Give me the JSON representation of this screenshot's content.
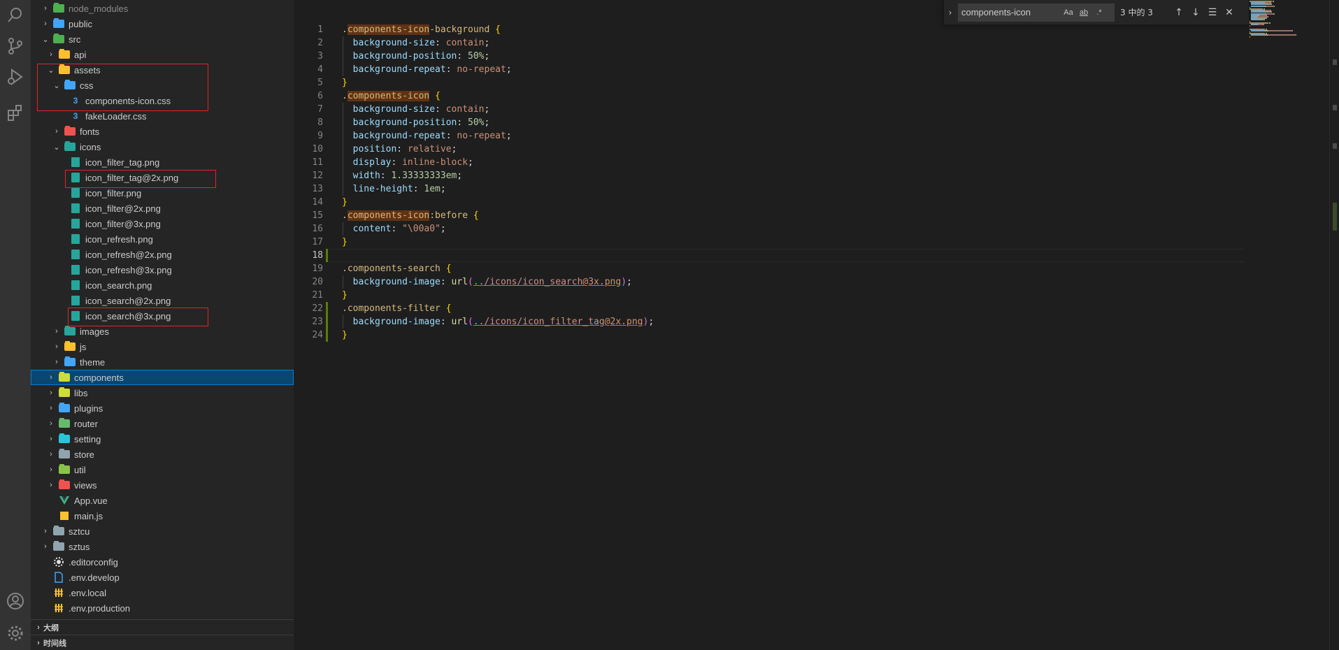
{
  "activity_bar": {
    "items": [
      {
        "name": "search-icon"
      },
      {
        "name": "source-control-icon"
      },
      {
        "name": "run-debug-icon"
      },
      {
        "name": "extensions-icon"
      }
    ],
    "bottom": [
      {
        "name": "account-icon"
      },
      {
        "name": "settings-gear-icon"
      }
    ]
  },
  "explorer": {
    "items": [
      {
        "label": "node_modules",
        "depth": 1,
        "type": "folder",
        "expanded": false,
        "color": "#4caf50",
        "dim": true
      },
      {
        "label": "public",
        "depth": 1,
        "type": "folder",
        "expanded": false,
        "color": "#42a5f5"
      },
      {
        "label": "src",
        "depth": 1,
        "type": "folder",
        "expanded": true,
        "color": "#4caf50"
      },
      {
        "label": "api",
        "depth": 2,
        "type": "folder",
        "expanded": false,
        "color": "#fbc02d"
      },
      {
        "label": "assets",
        "depth": 2,
        "type": "folder",
        "expanded": true,
        "color": "#fbc02d"
      },
      {
        "label": "css",
        "depth": 3,
        "type": "folder",
        "expanded": true,
        "color": "#42a5f5"
      },
      {
        "label": "components-icon.css",
        "depth": 4,
        "type": "css"
      },
      {
        "label": "fakeLoader.css",
        "depth": 4,
        "type": "css"
      },
      {
        "label": "fonts",
        "depth": 3,
        "type": "folder",
        "expanded": false,
        "color": "#ef5350"
      },
      {
        "label": "icons",
        "depth": 3,
        "type": "folder",
        "expanded": true,
        "color": "#26a69a"
      },
      {
        "label": "icon_filter_tag.png",
        "depth": 4,
        "type": "img"
      },
      {
        "label": "icon_filter_tag@2x.png",
        "depth": 4,
        "type": "img"
      },
      {
        "label": "icon_filter.png",
        "depth": 4,
        "type": "img"
      },
      {
        "label": "icon_filter@2x.png",
        "depth": 4,
        "type": "img"
      },
      {
        "label": "icon_filter@3x.png",
        "depth": 4,
        "type": "img"
      },
      {
        "label": "icon_refresh.png",
        "depth": 4,
        "type": "img"
      },
      {
        "label": "icon_refresh@2x.png",
        "depth": 4,
        "type": "img"
      },
      {
        "label": "icon_refresh@3x.png",
        "depth": 4,
        "type": "img"
      },
      {
        "label": "icon_search.png",
        "depth": 4,
        "type": "img"
      },
      {
        "label": "icon_search@2x.png",
        "depth": 4,
        "type": "img"
      },
      {
        "label": "icon_search@3x.png",
        "depth": 4,
        "type": "img"
      },
      {
        "label": "images",
        "depth": 3,
        "type": "folder",
        "expanded": false,
        "color": "#26a69a"
      },
      {
        "label": "js",
        "depth": 3,
        "type": "folder",
        "expanded": false,
        "color": "#fbc02d"
      },
      {
        "label": "theme",
        "depth": 3,
        "type": "folder",
        "expanded": false,
        "color": "#42a5f5"
      },
      {
        "label": "components",
        "depth": 2,
        "type": "folder",
        "expanded": false,
        "color": "#cddc39",
        "selected": true
      },
      {
        "label": "libs",
        "depth": 2,
        "type": "folder",
        "expanded": false,
        "color": "#cddc39"
      },
      {
        "label": "plugins",
        "depth": 2,
        "type": "folder",
        "expanded": false,
        "color": "#42a5f5"
      },
      {
        "label": "router",
        "depth": 2,
        "type": "folder",
        "expanded": false,
        "color": "#66bb6a"
      },
      {
        "label": "setting",
        "depth": 2,
        "type": "folder",
        "expanded": false,
        "color": "#26c6da"
      },
      {
        "label": "store",
        "depth": 2,
        "type": "folder",
        "expanded": false,
        "color": "#90a4ae"
      },
      {
        "label": "util",
        "depth": 2,
        "type": "folder",
        "expanded": false,
        "color": "#8bc34a"
      },
      {
        "label": "views",
        "depth": 2,
        "type": "folder",
        "expanded": false,
        "color": "#ef5350"
      },
      {
        "label": "App.vue",
        "depth": 2,
        "type": "vue"
      },
      {
        "label": "main.js",
        "depth": 2,
        "type": "js"
      },
      {
        "label": "sztcu",
        "depth": 1,
        "type": "folder",
        "expanded": false,
        "color": "#90a4ae"
      },
      {
        "label": "sztus",
        "depth": 1,
        "type": "folder",
        "expanded": false,
        "color": "#90a4ae"
      },
      {
        "label": ".editorconfig",
        "depth": 1,
        "type": "config"
      },
      {
        "label": ".env.develop",
        "depth": 1,
        "type": "doc"
      },
      {
        "label": ".env.local",
        "depth": 1,
        "type": "env"
      },
      {
        "label": ".env.production",
        "depth": 1,
        "type": "env"
      }
    ],
    "outline_label": "大纲",
    "timeline_label": "时间线"
  },
  "find": {
    "query": "components-icon",
    "match_case": "Aa",
    "whole_word": "ab",
    "regex": ".*",
    "count": "3 中的 3"
  },
  "editor": {
    "active_line": 18,
    "lines": [
      [
        [
          "sel",
          "."
        ],
        [
          "sel-hl",
          "components-icon"
        ],
        [
          "sel",
          "-background"
        ],
        [
          "punct",
          " "
        ],
        [
          "brace1",
          "{"
        ]
      ],
      [
        [
          "prop",
          "  background-size"
        ],
        [
          "punct",
          ": "
        ],
        [
          "val",
          "contain"
        ],
        [
          "punct",
          ";"
        ]
      ],
      [
        [
          "prop",
          "  background-position"
        ],
        [
          "punct",
          ": "
        ],
        [
          "num",
          "50%"
        ],
        [
          "punct",
          ";"
        ]
      ],
      [
        [
          "prop",
          "  background-repeat"
        ],
        [
          "punct",
          ": "
        ],
        [
          "val",
          "no-repeat"
        ],
        [
          "punct",
          ";"
        ]
      ],
      [
        [
          "brace1",
          "}"
        ]
      ],
      [
        [
          "sel",
          "."
        ],
        [
          "sel-hl",
          "components-icon"
        ],
        [
          "punct",
          " "
        ],
        [
          "brace1",
          "{"
        ]
      ],
      [
        [
          "prop",
          "  background-size"
        ],
        [
          "punct",
          ": "
        ],
        [
          "val",
          "contain"
        ],
        [
          "punct",
          ";"
        ]
      ],
      [
        [
          "prop",
          "  background-position"
        ],
        [
          "punct",
          ": "
        ],
        [
          "num",
          "50%"
        ],
        [
          "punct",
          ";"
        ]
      ],
      [
        [
          "prop",
          "  background-repeat"
        ],
        [
          "punct",
          ": "
        ],
        [
          "val",
          "no-repeat"
        ],
        [
          "punct",
          ";"
        ]
      ],
      [
        [
          "prop",
          "  position"
        ],
        [
          "punct",
          ": "
        ],
        [
          "val",
          "relative"
        ],
        [
          "punct",
          ";"
        ]
      ],
      [
        [
          "prop",
          "  display"
        ],
        [
          "punct",
          ": "
        ],
        [
          "val",
          "inline-block"
        ],
        [
          "punct",
          ";"
        ]
      ],
      [
        [
          "prop",
          "  width"
        ],
        [
          "punct",
          ": "
        ],
        [
          "num",
          "1.33333333em"
        ],
        [
          "punct",
          ";"
        ]
      ],
      [
        [
          "prop",
          "  line-height"
        ],
        [
          "punct",
          ": "
        ],
        [
          "num",
          "1em"
        ],
        [
          "punct",
          ";"
        ]
      ],
      [
        [
          "brace1",
          "}"
        ]
      ],
      [
        [
          "sel",
          "."
        ],
        [
          "sel-hl",
          "components-icon"
        ],
        [
          "pseudo",
          ":before"
        ],
        [
          "punct",
          " "
        ],
        [
          "brace1",
          "{"
        ]
      ],
      [
        [
          "prop",
          "  content"
        ],
        [
          "punct",
          ": "
        ],
        [
          "str",
          "\"\\00a0\""
        ],
        [
          "punct",
          ";"
        ]
      ],
      [
        [
          "brace1",
          "}"
        ]
      ],
      [],
      [
        [
          "sel",
          ".components-search"
        ],
        [
          "punct",
          " "
        ],
        [
          "brace1",
          "{"
        ]
      ],
      [
        [
          "prop",
          "  background-image"
        ],
        [
          "punct",
          ": "
        ],
        [
          "fn",
          "url"
        ],
        [
          "brace2",
          "("
        ],
        [
          "url",
          "../icons/icon_search@3x.png"
        ],
        [
          "brace2",
          ")"
        ],
        [
          "punct",
          ";"
        ]
      ],
      [
        [
          "brace1",
          "}"
        ]
      ],
      [
        [
          "sel",
          ".components-filter"
        ],
        [
          "punct",
          " "
        ],
        [
          "brace1",
          "{"
        ]
      ],
      [
        [
          "prop",
          "  background-image"
        ],
        [
          "punct",
          ": "
        ],
        [
          "fn",
          "url"
        ],
        [
          "brace2",
          "("
        ],
        [
          "url",
          "../icons/icon_filter_tag@2x.png"
        ],
        [
          "brace2",
          ")"
        ],
        [
          "punct",
          ";"
        ]
      ],
      [
        [
          "brace1",
          "}"
        ]
      ]
    ],
    "modified_lines": [
      18,
      22,
      23,
      24
    ]
  }
}
